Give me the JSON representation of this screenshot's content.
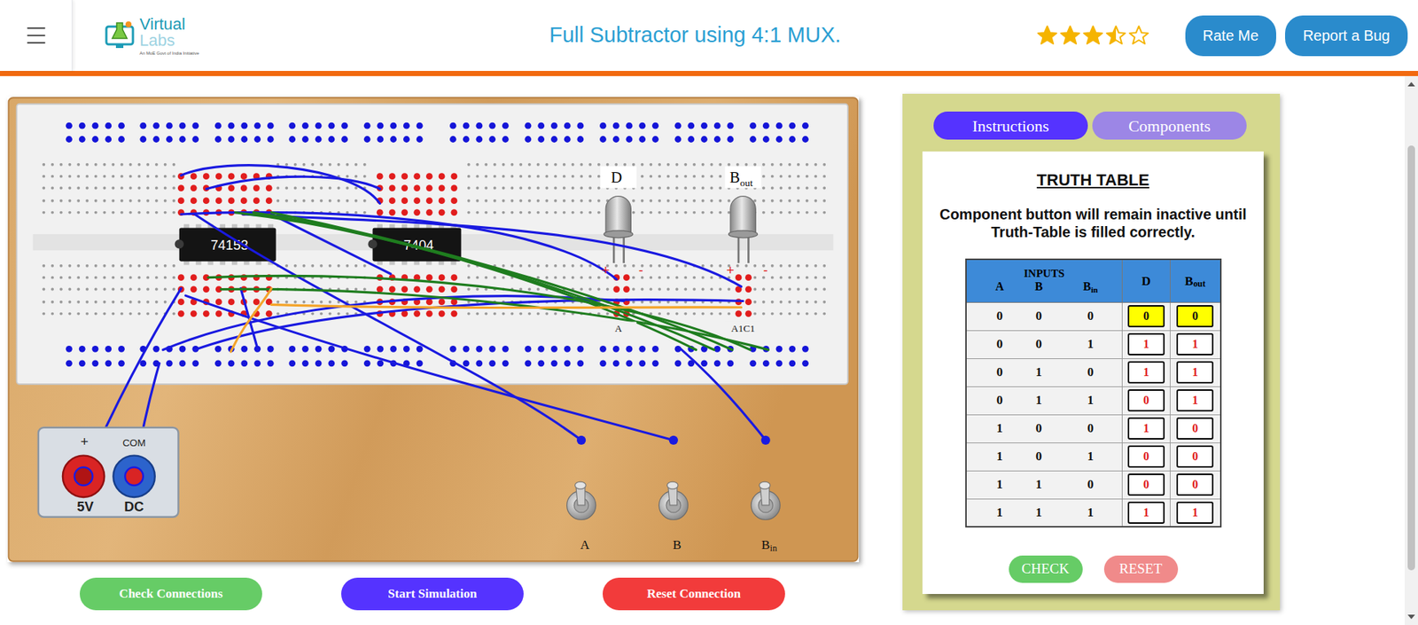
{
  "header": {
    "logo": {
      "line1": "Virtual",
      "line2": "Labs",
      "tagline": "An MoE Govt of India Initiative"
    },
    "title": "Full Subtractor using 4:1 MUX.",
    "rating": {
      "stars": 3.5,
      "max": 5
    },
    "buttons": [
      "Rate Me",
      "Report a Bug"
    ]
  },
  "breadboard": {
    "chips": [
      {
        "label": "74153"
      },
      {
        "label": "7404"
      }
    ],
    "leds": [
      {
        "label": "D",
        "sub": "",
        "lit": false,
        "pin_label": "A"
      },
      {
        "label": "B",
        "sub": "out",
        "lit": false,
        "pin_label": "A1C1"
      }
    ],
    "polarity": {
      "plus": "+",
      "minus": "-"
    },
    "switches": [
      {
        "label": "A",
        "sub": "",
        "on": false
      },
      {
        "label": "B",
        "sub": "",
        "on": false
      },
      {
        "label": "B",
        "sub": "in",
        "on": false
      }
    ],
    "power": {
      "plus": "+",
      "com": "COM",
      "voltage": "5V",
      "type": "DC"
    }
  },
  "bottom_buttons": [
    {
      "label": "Check Connections",
      "color": "#66cc66"
    },
    {
      "label": "Start Simulation",
      "color": "#5533ff"
    },
    {
      "label": "Reset Connection",
      "color": "#f23b3b"
    }
  ],
  "panel": {
    "tabs": [
      {
        "label": "Instructions",
        "selected": true,
        "disabled": false
      },
      {
        "label": "Components",
        "selected": false,
        "disabled": true
      }
    ],
    "truth_table": {
      "title": "TRUTH TABLE",
      "note": "Component button will remain inactive until Truth-Table is filled correctly.",
      "group": "INPUTS",
      "input_columns": [
        {
          "label": "A",
          "sub": ""
        },
        {
          "label": "B",
          "sub": ""
        },
        {
          "label": "B",
          "sub": "in"
        }
      ],
      "output_columns": [
        {
          "label": "D",
          "sub": ""
        },
        {
          "label": "B",
          "sub": "out"
        }
      ],
      "rows": [
        {
          "inputs": [
            "0",
            "0",
            "0"
          ],
          "outputs": [
            "0",
            "0"
          ],
          "highlighted": true
        },
        {
          "inputs": [
            "0",
            "0",
            "1"
          ],
          "outputs": [
            "1",
            "1"
          ],
          "highlighted": false
        },
        {
          "inputs": [
            "0",
            "1",
            "0"
          ],
          "outputs": [
            "1",
            "1"
          ],
          "highlighted": false
        },
        {
          "inputs": [
            "0",
            "1",
            "1"
          ],
          "outputs": [
            "0",
            "1"
          ],
          "highlighted": false
        },
        {
          "inputs": [
            "1",
            "0",
            "0"
          ],
          "outputs": [
            "1",
            "0"
          ],
          "highlighted": false
        },
        {
          "inputs": [
            "1",
            "0",
            "1"
          ],
          "outputs": [
            "0",
            "0"
          ],
          "highlighted": false
        },
        {
          "inputs": [
            "1",
            "1",
            "0"
          ],
          "outputs": [
            "0",
            "0"
          ],
          "highlighted": false
        },
        {
          "inputs": [
            "1",
            "1",
            "1"
          ],
          "outputs": [
            "1",
            "1"
          ],
          "highlighted": false
        }
      ]
    },
    "buttons": [
      {
        "label": "CHECK",
        "disabled": false
      },
      {
        "label": "RESET",
        "disabled": true
      }
    ]
  }
}
